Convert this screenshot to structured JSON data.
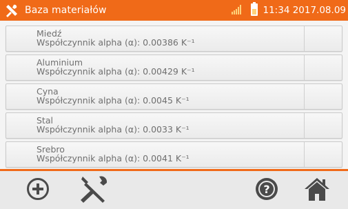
{
  "header": {
    "title": "Baza materiałów",
    "clock": "11:34 2017.08.09",
    "icons": [
      "tools-icon",
      "signal-icon",
      "battery-icon"
    ]
  },
  "materials": [
    {
      "name": "Miedź",
      "coefficient": "Współczynnik alpha (α): 0.00386 K⁻¹"
    },
    {
      "name": "Aluminium",
      "coefficient": "Współczynnik alpha (α): 0.00429 K⁻¹"
    },
    {
      "name": "Cyna",
      "coefficient": "Współczynnik alpha (α): 0.0045 K⁻¹"
    },
    {
      "name": "Stal",
      "coefficient": "Współczynnik alpha (α): 0.0033 K⁻¹"
    },
    {
      "name": "Srebro",
      "coefficient": "Współczynnik alpha (α): 0.0041 K⁻¹"
    }
  ],
  "toolbar": {
    "buttons": [
      "add-icon",
      "tools-icon",
      "help-icon",
      "home-icon"
    ]
  },
  "colors": {
    "accent": "#f06a18",
    "icon": "#4a4a4a",
    "text": "#6f6f6f"
  }
}
